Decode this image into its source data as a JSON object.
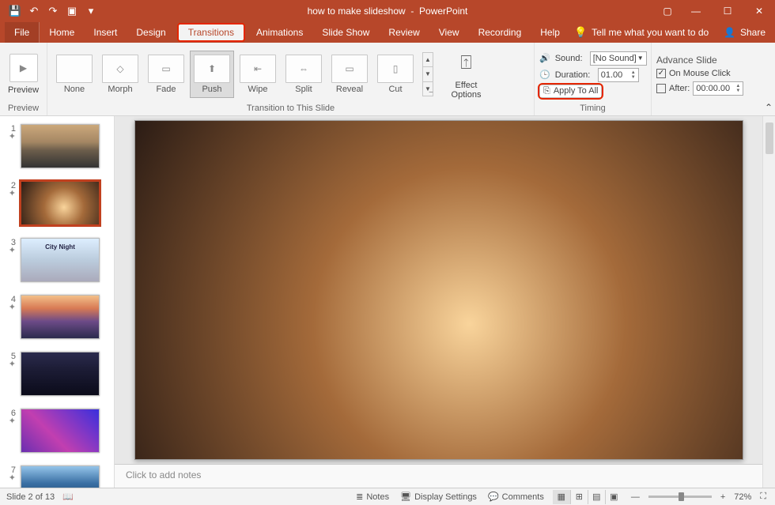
{
  "title": {
    "doc": "how to make slideshow",
    "app": "PowerPoint"
  },
  "qat": {
    "save": "💾",
    "undo": "↶",
    "redo": "↷",
    "start": "▣",
    "more": "▾"
  },
  "tabs": {
    "file": "File",
    "items": [
      "Home",
      "Insert",
      "Design",
      "Transitions",
      "Animations",
      "Slide Show",
      "Review",
      "View",
      "Recording",
      "Help"
    ],
    "tellme_placeholder": "Tell me what you want to do",
    "share": "Share"
  },
  "ribbon": {
    "preview": {
      "label": "Preview",
      "group": "Preview"
    },
    "transition_group": "Transition to This Slide",
    "gallery": [
      {
        "name": "None",
        "glyph": ""
      },
      {
        "name": "Morph",
        "glyph": "◇"
      },
      {
        "name": "Fade",
        "glyph": "▭"
      },
      {
        "name": "Push",
        "glyph": "⬆",
        "selected": true
      },
      {
        "name": "Wipe",
        "glyph": "⇤"
      },
      {
        "name": "Split",
        "glyph": "⇔"
      },
      {
        "name": "Reveal",
        "glyph": "▭"
      },
      {
        "name": "Cut",
        "glyph": "▯"
      }
    ],
    "effect_options": {
      "label": "Effect\nOptions",
      "glyph": "⍐"
    },
    "timing": {
      "sound_label": "Sound:",
      "sound_value": "[No Sound]",
      "duration_label": "Duration:",
      "duration_value": "01.00",
      "apply_all": "Apply To All",
      "group": "Timing"
    },
    "advance": {
      "title": "Advance Slide",
      "onclick": "On Mouse Click",
      "onclick_checked": true,
      "after": "After:",
      "after_checked": false,
      "after_value": "00:00.00"
    }
  },
  "thumbs": [
    {
      "num": "1",
      "cls": "bg-night1"
    },
    {
      "num": "2",
      "cls": "bg-night2",
      "selected": true
    },
    {
      "num": "3",
      "cls": "bg-cityday",
      "caption": "City Night"
    },
    {
      "num": "4",
      "cls": "bg-sunset"
    },
    {
      "num": "5",
      "cls": "bg-dark"
    },
    {
      "num": "6",
      "cls": "bg-neon"
    },
    {
      "num": "7",
      "cls": "bg-blue"
    }
  ],
  "notes_placeholder": "Click to add notes",
  "status": {
    "slide": "Slide 2 of 13",
    "notes": "Notes",
    "display": "Display Settings",
    "comments": "Comments",
    "zoom": "72%"
  }
}
